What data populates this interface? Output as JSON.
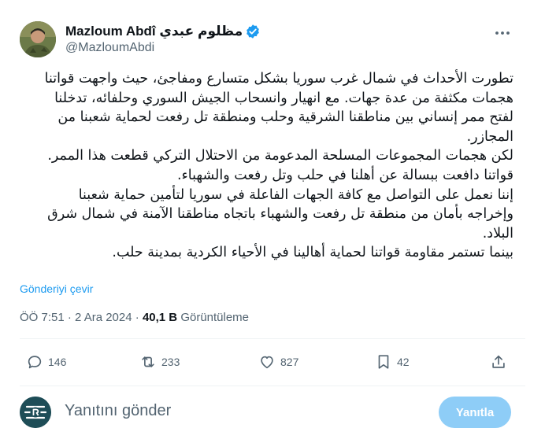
{
  "author": {
    "display_name_latin": "Mazloum Abdî",
    "display_name_arabic": "مظلوم عبدي",
    "handle": "@MazloumAbdi",
    "verified": true
  },
  "tweet": {
    "lines": [
      "تطورت الأحداث في شمال غرب سوريا بشكل متسارع ومفاجئ، حيث واجهت قواتنا",
      "هجمات مكثفة من عدة جهات. مع انهيار وانسحاب الجيش السوري وحلفائه، تدخلنا",
      "لفتح ممر إنساني بين مناطقنا الشرقية وحلب ومنطقة تل رفعت لحماية شعبنا من",
      "المجازر.",
      "لكن هجمات المجموعات المسلحة المدعومة من الاحتلال التركي قطعت هذا الممر.",
      "قواتنا دافعت ببسالة عن أهلنا في حلب وتل رفعت والشهباء.",
      "إننا نعمل على التواصل مع كافة الجهات الفاعلة في سوريا لتأمين حماية شعبنا",
      "وإخراجه بأمان من منطقة تل رفعت والشهباء باتجاه مناطقنا الآمنة في شمال شرق",
      "البلاد.",
      "بينما تستمر مقاومة قواتنا لحماية أهالينا في الأحياء الكردية بمدينة حلب."
    ],
    "translate_label": "Gönderiyi çevir",
    "time": "ÖÖ 7:51 · 2 Ara 2024 ·",
    "views_count": "40,1 B",
    "views_label": "Görüntüleme"
  },
  "actions": {
    "replies": "146",
    "reposts": "233",
    "likes": "827",
    "bookmarks": "42"
  },
  "composer": {
    "placeholder": "Yanıtını gönder",
    "button_label": "Yanıtla"
  },
  "icons": {
    "verified": "verified-badge-icon",
    "more": "more-horizontal-icon",
    "reply": "reply-icon",
    "repost": "repost-icon",
    "like": "heart-icon",
    "bookmark": "bookmark-icon",
    "share": "share-icon"
  },
  "colors": {
    "accent": "#1d9bf0",
    "secondary_text": "#536471",
    "button_disabled": "#8ecdf7"
  }
}
